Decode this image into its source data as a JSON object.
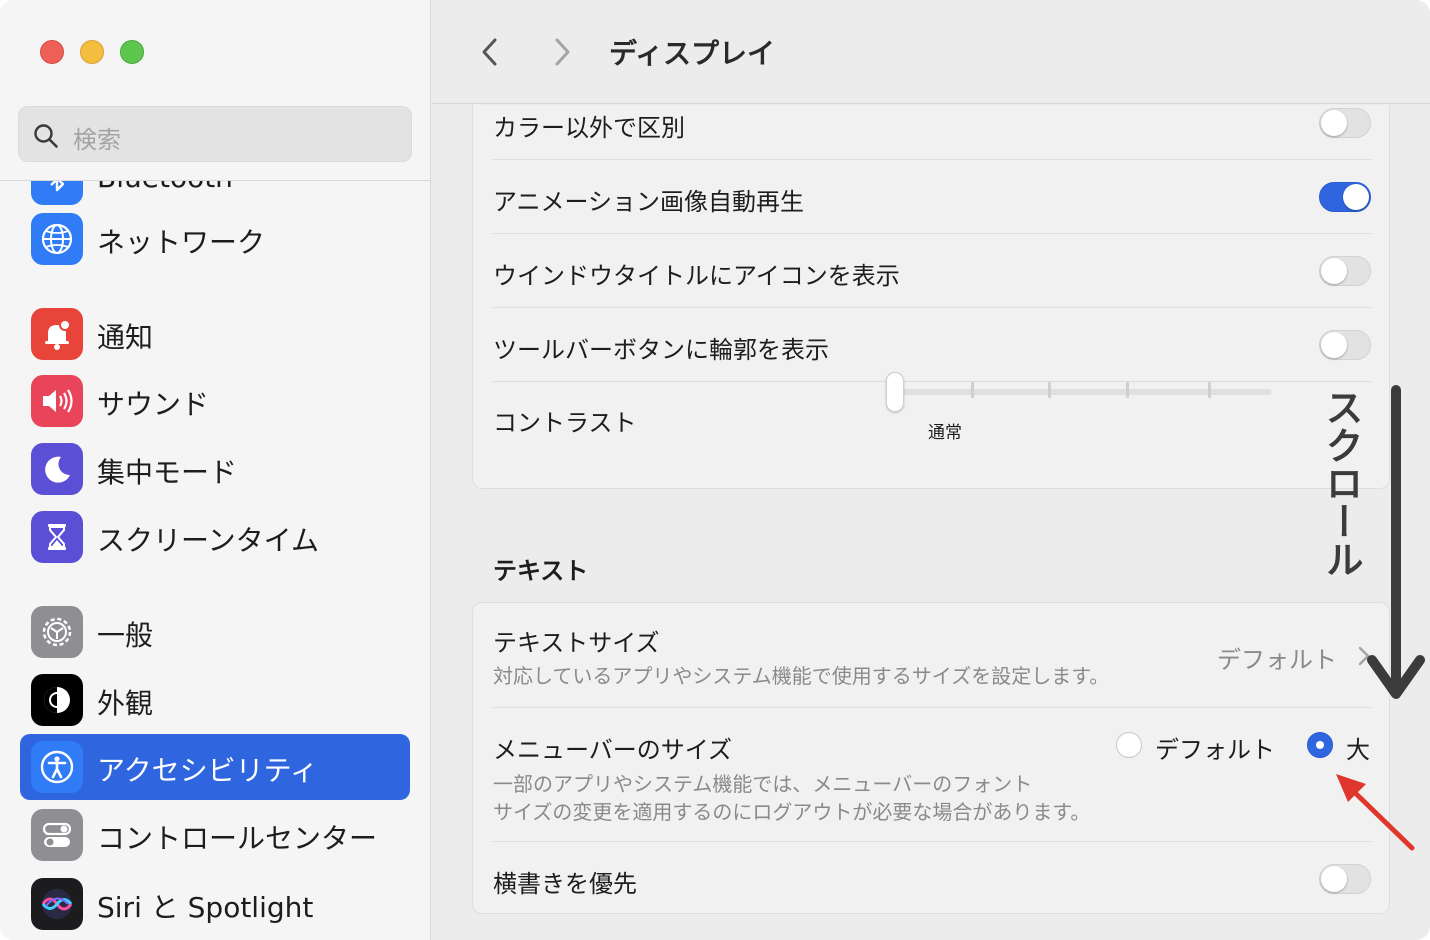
{
  "window": {
    "title": "ディスプレイ"
  },
  "sidebar": {
    "search_placeholder": "検索",
    "partial_item": "Bluetooth",
    "items": [
      {
        "label": "ネットワーク",
        "icon": "globe-icon",
        "color": "#2f7cf6"
      },
      {
        "label": "通知",
        "icon": "bell-icon",
        "color": "#e8443a"
      },
      {
        "label": "サウンド",
        "icon": "speaker-icon",
        "color": "#e8445a"
      },
      {
        "label": "集中モード",
        "icon": "moon-icon",
        "color": "#5b4fd6"
      },
      {
        "label": "スクリーンタイム",
        "icon": "hourglass-icon",
        "color": "#5b4fd6"
      },
      {
        "label": "一般",
        "icon": "gear-icon",
        "color": "#8e8e93"
      },
      {
        "label": "外観",
        "icon": "appearance-icon",
        "color": "#000000"
      },
      {
        "label": "アクセシビリティ",
        "icon": "accessibility-icon",
        "color": "#2f7cf6",
        "selected": true
      },
      {
        "label": "コントロールセンター",
        "icon": "toggles-icon",
        "color": "#8e8e93"
      },
      {
        "label": "Siri と Spotlight",
        "icon": "siri-icon",
        "color": "#1c1c1e"
      }
    ]
  },
  "display": {
    "rows": [
      {
        "label": "カラー以外で区別",
        "on": false
      },
      {
        "label": "アニメーション画像自動再生",
        "on": true
      },
      {
        "label": "ウインドウタイトルにアイコンを表示",
        "on": false
      },
      {
        "label": "ツールバーボタンに輪郭を表示",
        "on": false
      }
    ],
    "contrast": {
      "label": "コントラスト",
      "value_label": "通常",
      "level": 0
    }
  },
  "text_section": {
    "title": "テキスト",
    "text_size": {
      "label": "テキストサイズ",
      "description": "対応しているアプリやシステム機能で使用するサイズを設定します。",
      "value": "デフォルト"
    },
    "menubar_size": {
      "label": "メニューバーのサイズ",
      "description_line1": "一部のアプリやシステム機能では、メニューバーのフォント",
      "description_line2": "サイズの変更を適用するのにログアウトが必要な場合があります。",
      "options": [
        "デフォルト",
        "大"
      ],
      "selected": "大"
    },
    "horizontal_first": {
      "label": "横書きを優先",
      "on": false
    }
  },
  "annotation": {
    "scroll_text": "スクロール",
    "arrow_color": "#3b3b3b",
    "highlight_arrow_color": "#e0372c"
  }
}
